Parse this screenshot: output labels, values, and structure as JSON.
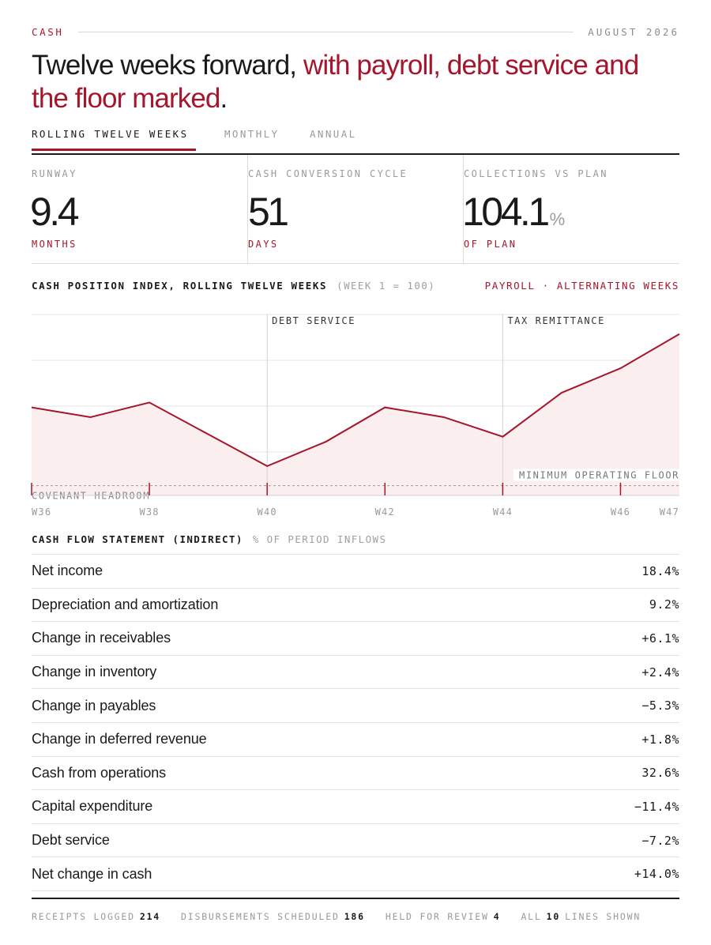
{
  "header": {
    "section": "CASH",
    "date": "AUGUST 2026",
    "headline_plain": "Twelve weeks forward, ",
    "headline_accent": "with payroll, debt service and the floor marked",
    "headline_end": "."
  },
  "tabs": [
    {
      "label": "ROLLING TWELVE WEEKS",
      "active": true
    },
    {
      "label": "MONTHLY",
      "active": false
    },
    {
      "label": "ANNUAL",
      "active": false
    }
  ],
  "kpis": [
    {
      "label": "RUNWAY",
      "value": "9.4",
      "suffix": "",
      "unit": "MONTHS"
    },
    {
      "label": "CASH CONVERSION CYCLE",
      "value": "51",
      "suffix": "",
      "unit": "DAYS"
    },
    {
      "label": "COLLECTIONS VS PLAN",
      "value": "104.1",
      "suffix": "%",
      "unit": "OF PLAN"
    }
  ],
  "chart": {
    "title": "CASH POSITION INDEX, ROLLING TWELVE WEEKS",
    "subtitle": "(WEEK 1 = 100)",
    "legend": "PAYROLL · ALTERNATING WEEKS"
  },
  "chart_data": {
    "type": "area",
    "x": [
      "W36",
      "W37",
      "W38",
      "W39",
      "W40",
      "W41",
      "W42",
      "W43",
      "W44",
      "W45",
      "W46",
      "W47"
    ],
    "values": [
      108,
      106,
      109,
      102.5,
      96,
      101,
      108,
      106,
      102,
      111,
      116,
      123
    ],
    "ylim": [
      90,
      127
    ],
    "tick_labels": [
      "W36",
      "W38",
      "W40",
      "W42",
      "W44",
      "W46",
      "W47"
    ],
    "payroll_weeks": [
      "W36",
      "W38",
      "W40",
      "W42",
      "W44",
      "W46"
    ],
    "annotations": [
      {
        "x": "W40",
        "label": "DEBT SERVICE"
      },
      {
        "x": "W44",
        "label": "TAX REMITTANCE"
      }
    ],
    "reference_line": {
      "label": "MINIMUM OPERATING FLOOR",
      "value": 92
    },
    "band_label": "COVENANT HEADROOM",
    "colors": {
      "line": "#a5162c",
      "fill": "#fbeeee",
      "grid": "#e6e6e6"
    }
  },
  "cash_flow": {
    "title": "CASH FLOW STATEMENT (INDIRECT)",
    "subtitle": "% OF PERIOD INFLOWS",
    "rows": [
      {
        "label": "Net income",
        "value": "18.4%"
      },
      {
        "label": "Depreciation and amortization",
        "value": "9.2%"
      },
      {
        "label": "Change in receivables",
        "value": "+6.1%"
      },
      {
        "label": "Change in inventory",
        "value": "+2.4%"
      },
      {
        "label": "Change in payables",
        "value": "−5.3%"
      },
      {
        "label": "Change in deferred revenue",
        "value": "+1.8%"
      },
      {
        "label": "Cash from operations",
        "value": "32.6%"
      },
      {
        "label": "Capital expenditure",
        "value": "−11.4%"
      },
      {
        "label": "Debt service",
        "value": "−7.2%"
      },
      {
        "label": "Net change in cash",
        "value": "+14.0%"
      }
    ]
  },
  "footer": {
    "receipts_label": "RECEIPTS LOGGED",
    "receipts_value": "214",
    "disb_label": "DISBURSEMENTS SCHEDULED",
    "disb_value": "186",
    "held_label": "HELD FOR REVIEW",
    "held_value": "4",
    "all_label": "ALL",
    "all_value": "10",
    "lines_label": "LINES SHOWN"
  }
}
